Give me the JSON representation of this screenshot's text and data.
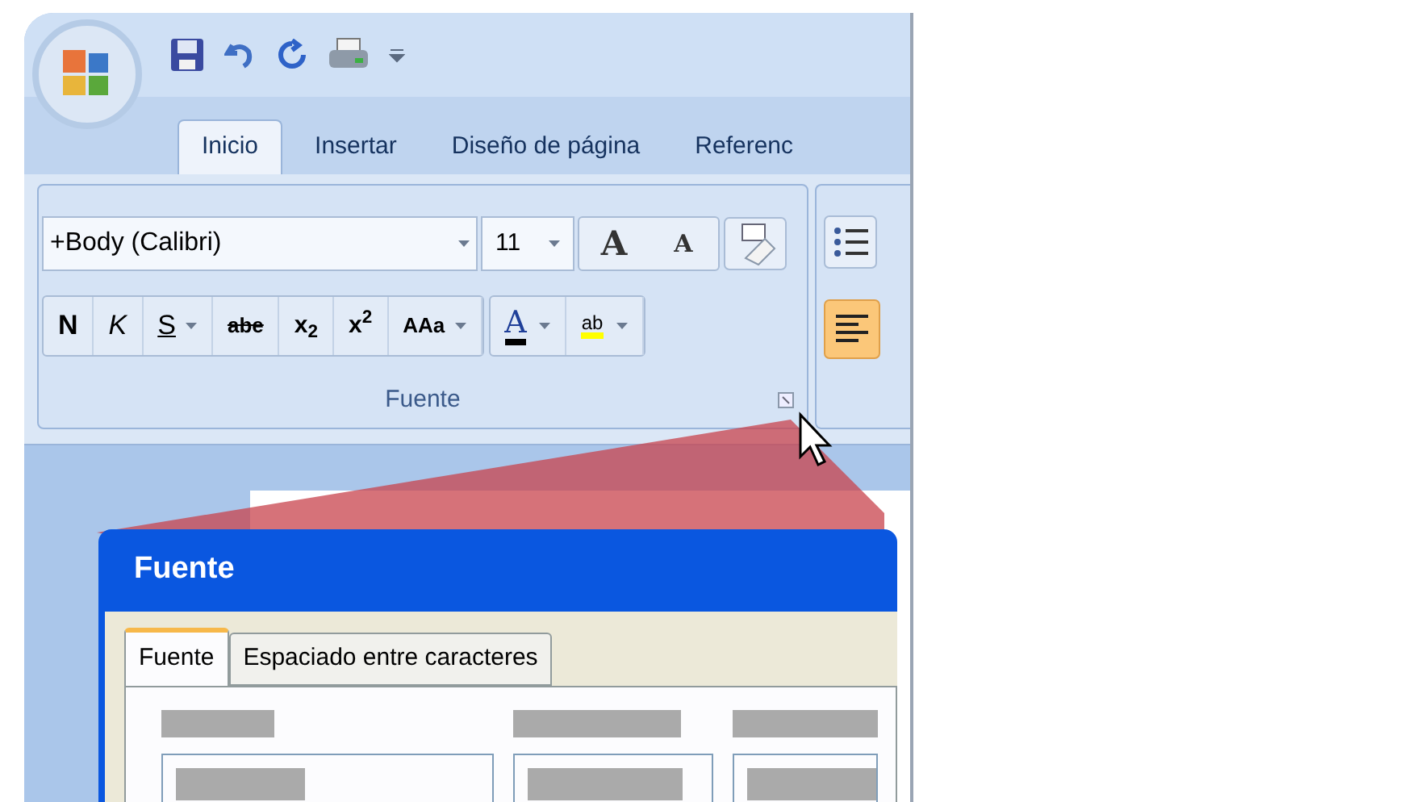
{
  "tabs": [
    {
      "label": "Inicio",
      "selected": true
    },
    {
      "label": "Insertar",
      "selected": false
    },
    {
      "label": "Diseño de página",
      "selected": false
    },
    {
      "label": "Referenc",
      "selected": false
    }
  ],
  "font_group": {
    "font_name": "+Body (Calibri)",
    "font_size": "11",
    "title": "Fuente",
    "size_buttons": [
      {
        "kind": "grow",
        "label": "A"
      },
      {
        "kind": "shrink",
        "label": "A"
      }
    ],
    "format_buttons": [
      {
        "kind": "bold",
        "label": "N",
        "dropdown": false
      },
      {
        "kind": "italic",
        "label": "K",
        "dropdown": false
      },
      {
        "kind": "underline",
        "label": "S",
        "dropdown": true
      },
      {
        "kind": "strike",
        "label": "abe",
        "dropdown": false
      },
      {
        "kind": "script",
        "label": "x$_{2}$",
        "dropdown": false
      },
      {
        "kind": "script",
        "label": "x$^{2}$",
        "dropdown": false
      },
      {
        "kind": "case",
        "label": "AAa",
        "dropdown": true
      },
      {
        "kind": "font_color",
        "label": "A",
        "dropdown": true
      },
      {
        "kind": "highlight",
        "label": "ab",
        "dropdown": true
      }
    ]
  },
  "dialog": {
    "title": "Fuente",
    "tabs": [
      {
        "label": "Fuente",
        "selected": true
      },
      {
        "label": "Espaciado entre caracteres",
        "selected": false
      }
    ]
  }
}
